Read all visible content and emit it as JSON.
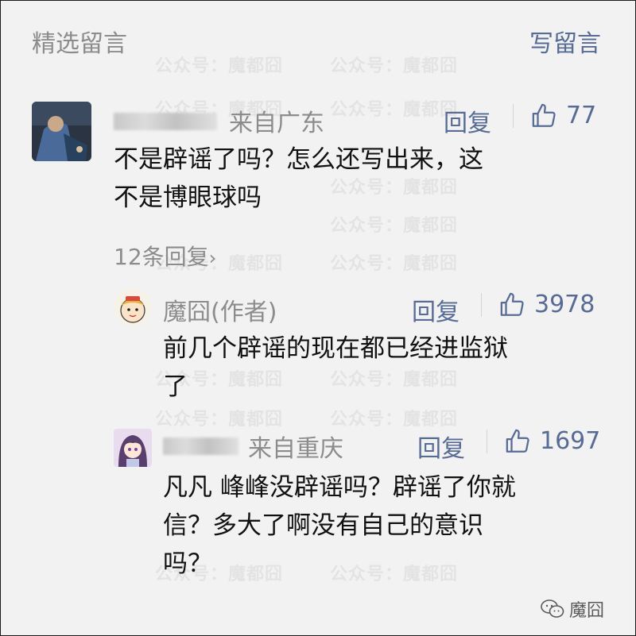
{
  "header": {
    "title": "精选留言",
    "write_label": "写留言"
  },
  "watermark_text": "公众号：魔都囧",
  "comments": [
    {
      "name_hidden": true,
      "location": "来自广东",
      "reply_label": "回复",
      "likes": "77",
      "text": "不是辟谣了吗？怎么还写出来，这\n不是博眼球吗",
      "replies_link": "12条回复",
      "replies": [
        {
          "author": "魔囧(作者)",
          "reply_label": "回复",
          "likes": "3978",
          "text": "前几个辟谣的现在都已经进监狱\n了"
        },
        {
          "name_hidden": true,
          "location": "来自重庆",
          "reply_label": "回复",
          "likes": "1697",
          "text": "凡凡 峰峰没辟谣吗？辟谣了你就\n信？多大了啊没有自己的意识\n吗？"
        }
      ]
    }
  ],
  "footer": {
    "brand": "魔囧",
    "icon": "wechat-icon"
  },
  "colors": {
    "accent": "#576b95",
    "muted": "#8c8c8c",
    "text": "#111111",
    "background": "#f2f2f2"
  }
}
